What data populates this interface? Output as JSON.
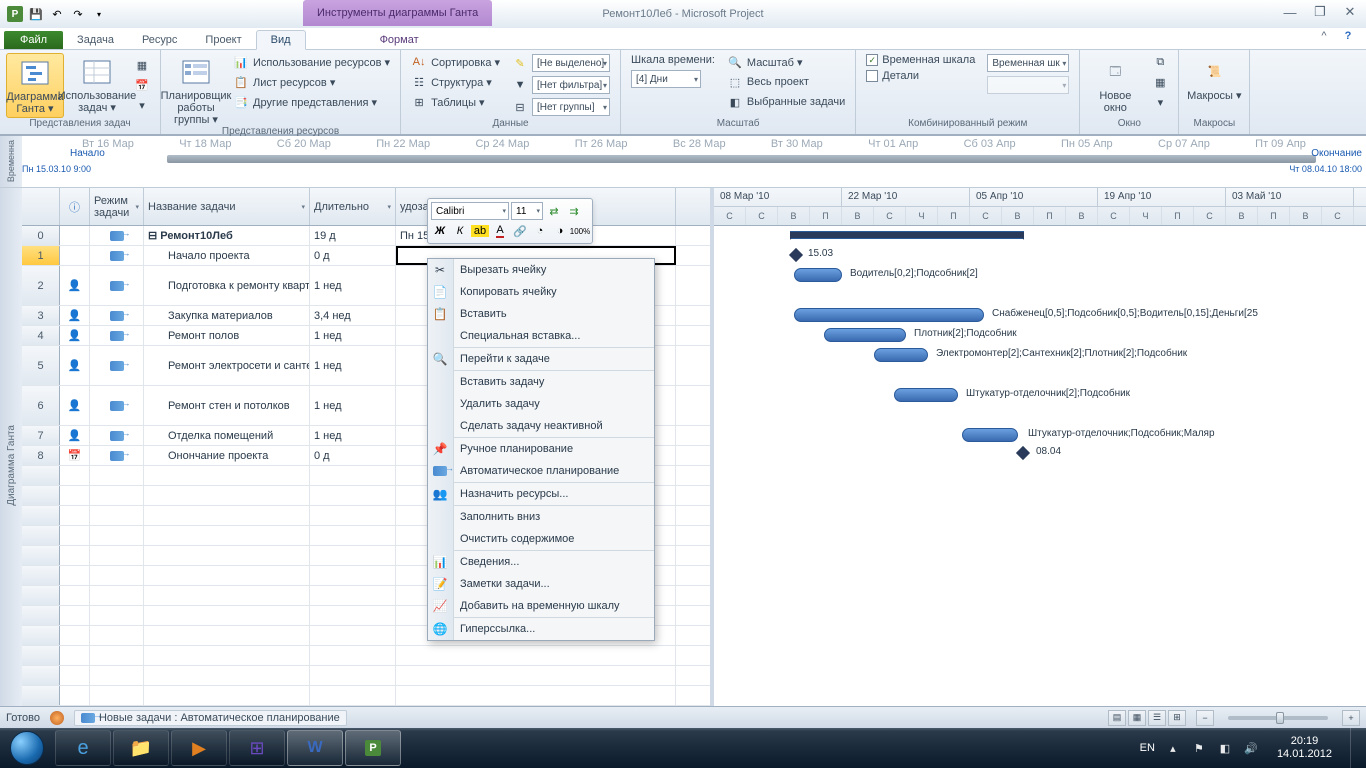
{
  "title": "Ремонт10Леб  -  Microsoft Project",
  "contextualTab": "Инструменты диаграммы Ганта",
  "fileTab": "Файл",
  "tabs": {
    "task": "Задача",
    "resource": "Ресурс",
    "project": "Проект",
    "view": "Вид",
    "format": "Формат"
  },
  "ribbon": {
    "g1": {
      "label": "Представления задач",
      "b1": "Диаграмма Ганта ▾",
      "b2": "Использование задач ▾"
    },
    "g2": {
      "label": "Представления ресурсов",
      "b1": "Планировщик работы группы ▾",
      "i1": "Использование ресурсов ▾",
      "i2": "Лист ресурсов ▾",
      "i3": "Другие представления ▾"
    },
    "g3": {
      "label": "Данные",
      "i1": "Сортировка ▾",
      "i2": "Структура ▾",
      "i3": "Таблицы ▾",
      "c1": "[Не выделено]",
      "c2": "[Нет фильтра]",
      "c3": "[Нет группы]"
    },
    "g4": {
      "label": "Масштаб",
      "l1": "Шкала времени:",
      "c1": "[4] Дни",
      "i1": "Масштаб ▾",
      "i2": "Весь проект",
      "i3": "Выбранные задачи"
    },
    "g5": {
      "label": "Комбинированный режим",
      "i1": "Временная шкала",
      "i2": "Детали",
      "c1": "Временная шк"
    },
    "g6": {
      "label": "Окно",
      "b1": "Новое окно"
    },
    "g7": {
      "label": "Макросы",
      "b1": "Макросы ▾"
    }
  },
  "timeline": {
    "sideLabel": "Временна",
    "dates": [
      "Вт 16 Мар",
      "Чт 18 Мар",
      "Сб 20 Мар",
      "Пн 22 Мар",
      "Ср 24 Мар",
      "Пт 26 Мар",
      "Вс 28 Мар",
      "Вт 30 Мар",
      "Чт 01 Апр",
      "Сб 03 Апр",
      "Пн 05 Апр",
      "Ср 07 Апр",
      "Пт 09 Апр"
    ],
    "startLbl": "Начало",
    "startDate": "Пн 15.03.10 9:00",
    "endLbl": "Окончание",
    "endDate": "Чт 08.04.10 18:00"
  },
  "grid": {
    "sideLabel": "Диаграмма Ганта",
    "headers": {
      "info": "ⓘ",
      "mode": "Режим задачи",
      "name": "Название задачи",
      "dur": "Длительно",
      "start": "удозатраты"
    },
    "rows": [
      {
        "idx": "0",
        "name": "Ремонт10Леб",
        "dur": "19 д",
        "start": "Пн 15.03.10 9  Чт 08.04.10 1   884,4 ч",
        "bold": true
      },
      {
        "idx": "1",
        "name": "Начало проекта",
        "dur": "0 д",
        "start": "",
        "indent": true,
        "sel": true
      },
      {
        "idx": "2",
        "name": "Подготовка к ремонту квартиры",
        "dur": "1 нед",
        "start": "",
        "indent": true,
        "warn": true,
        "tall": true
      },
      {
        "idx": "3",
        "name": "Закупка материалов",
        "dur": "3,4 нед",
        "start": "",
        "indent": true,
        "warn": true
      },
      {
        "idx": "4",
        "name": "Ремонт полов",
        "dur": "1 нед",
        "start": "",
        "indent": true,
        "warn": true
      },
      {
        "idx": "5",
        "name": "Ремонт электросети и сантехники",
        "dur": "1 нед",
        "start": "",
        "indent": true,
        "warn": true,
        "tall": true
      },
      {
        "idx": "6",
        "name": "Ремонт стен и потолков",
        "dur": "1 нед",
        "start": "",
        "indent": true,
        "warn": true,
        "tall": true
      },
      {
        "idx": "7",
        "name": "Отделка помещений",
        "dur": "1 нед",
        "start": "",
        "indent": true,
        "warn": true
      },
      {
        "idx": "8",
        "name": "Онончание проекта",
        "dur": "0 д",
        "start": "",
        "indent": true,
        "cal": true
      }
    ]
  },
  "gantt": {
    "topDates": [
      "08 Мар '10",
      "22 Мар '10",
      "05 Апр '10",
      "19 Апр '10",
      "03 Май '10"
    ],
    "botDays": [
      "С",
      "С",
      "В",
      "П",
      "В",
      "С",
      "Ч",
      "П",
      "С",
      "В",
      "П",
      "В",
      "С",
      "Ч",
      "П",
      "С",
      "В",
      "П",
      "В",
      "С"
    ],
    "labels": {
      "l1": "15.03",
      "l2": "Водитель[0,2];Подсобник[2]",
      "l3": "Снабженец[0,5];Подсобник[0,5];Водитель[0,15];Деньги[25",
      "l4": "Плотник[2];Подсобник",
      "l5": "Электромонтер[2];Сантехник[2];Плотник[2];Подсобник",
      "l6": "Штукатур-отделочник[2];Подсобник",
      "l7": "Штукатур-отделочник;Подсобник;Маляр",
      "l8": "08.04"
    }
  },
  "miniToolbar": {
    "font": "Calibri",
    "size": "11"
  },
  "contextMenu": {
    "cut": "Вырезать ячейку",
    "copy": "Копировать ячейку",
    "paste": "Вставить",
    "pasteSpecial": "Специальная вставка...",
    "goto": "Перейти к задаче",
    "insertTask": "Вставить задачу",
    "deleteTask": "Удалить задачу",
    "inactivate": "Сделать задачу неактивной",
    "manual": "Ручное планирование",
    "auto": "Автоматическое планирование",
    "assign": "Назначить ресурсы...",
    "fillDown": "Заполнить вниз",
    "clear": "Очистить содержимое",
    "info": "Сведения...",
    "notes": "Заметки задачи...",
    "addTimeline": "Добавить на временную шкалу",
    "hyperlink": "Гиперссылка..."
  },
  "status": {
    "ready": "Готово",
    "newTasks": "Новые задачи : Автоматическое планирование"
  },
  "tray": {
    "lang": "EN",
    "time": "20:19",
    "date": "14.01.2012"
  }
}
